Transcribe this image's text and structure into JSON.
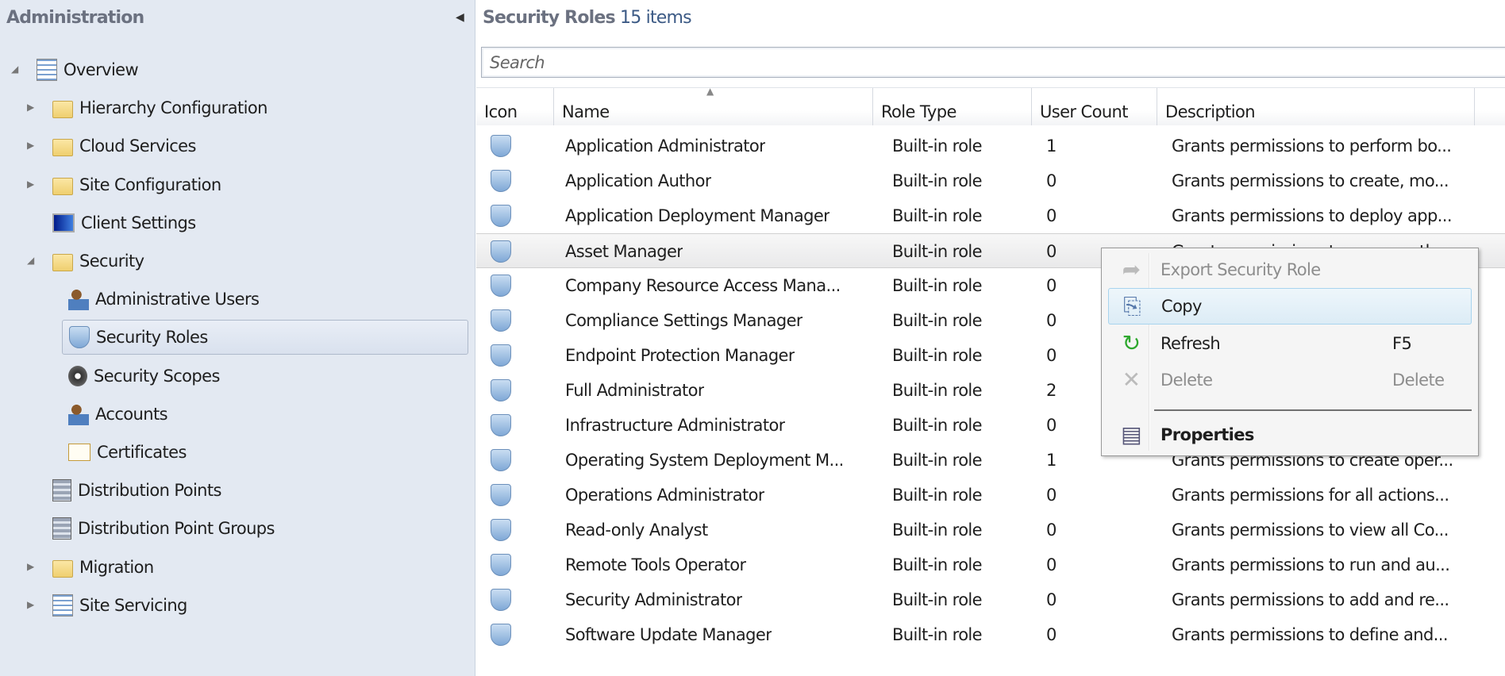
{
  "sidebar": {
    "title": "Administration",
    "items": [
      {
        "label": "Overview",
        "icon": "overview-icon",
        "expander": "expanded"
      },
      {
        "label": "Hierarchy Configuration",
        "icon": "folder-icon",
        "expander": "collapsed"
      },
      {
        "label": "Cloud Services",
        "icon": "folder-icon",
        "expander": "collapsed"
      },
      {
        "label": "Site Configuration",
        "icon": "folder-icon",
        "expander": "collapsed"
      },
      {
        "label": "Client Settings",
        "icon": "monitor-icon",
        "expander": "none"
      },
      {
        "label": "Security",
        "icon": "folder-icon",
        "expander": "expanded"
      },
      {
        "label": "Administrative Users",
        "icon": "admin-user-icon",
        "expander": "none"
      },
      {
        "label": "Security Roles",
        "icon": "security-role-icon",
        "expander": "none",
        "selected": true
      },
      {
        "label": "Security Scopes",
        "icon": "lock-icon",
        "expander": "none"
      },
      {
        "label": "Accounts",
        "icon": "account-icon",
        "expander": "none"
      },
      {
        "label": "Certificates",
        "icon": "certificate-icon",
        "expander": "none"
      },
      {
        "label": "Distribution Points",
        "icon": "server-icon",
        "expander": "none"
      },
      {
        "label": "Distribution Point Groups",
        "icon": "server-group-icon",
        "expander": "none"
      },
      {
        "label": "Migration",
        "icon": "folder-icon",
        "expander": "collapsed"
      },
      {
        "label": "Site Servicing",
        "icon": "site-servicing-icon",
        "expander": "collapsed"
      }
    ]
  },
  "main": {
    "title": "Security Roles",
    "count": "15 items",
    "search_placeholder": "Search",
    "columns": [
      "Icon",
      "Name",
      "Role Type",
      "User Count",
      "Description"
    ],
    "rows": [
      {
        "name": "Application Administrator",
        "type": "Built-in role",
        "count": "1",
        "desc": "Grants permissions to perform bo..."
      },
      {
        "name": "Application Author",
        "type": "Built-in role",
        "count": "0",
        "desc": "Grants permissions to create, mo..."
      },
      {
        "name": "Application Deployment Manager",
        "type": "Built-in role",
        "count": "0",
        "desc": "Grants permissions to deploy app..."
      },
      {
        "name": "Asset Manager",
        "type": "Built-in role",
        "count": "0",
        "desc": "Grants permissions to manage th...",
        "selected": true
      },
      {
        "name": "Company Resource Access Mana...",
        "type": "Built-in role",
        "count": "0",
        "desc": ""
      },
      {
        "name": "Compliance Settings Manager",
        "type": "Built-in role",
        "count": "0",
        "desc": ""
      },
      {
        "name": "Endpoint Protection Manager",
        "type": "Built-in role",
        "count": "0",
        "desc": ""
      },
      {
        "name": "Full Administrator",
        "type": "Built-in role",
        "count": "2",
        "desc": ""
      },
      {
        "name": "Infrastructure Administrator",
        "type": "Built-in role",
        "count": "0",
        "desc": ""
      },
      {
        "name": "Operating System Deployment M...",
        "type": "Built-in role",
        "count": "1",
        "desc": "Grants permissions to create oper..."
      },
      {
        "name": "Operations Administrator",
        "type": "Built-in role",
        "count": "0",
        "desc": "Grants permissions for all actions..."
      },
      {
        "name": "Read-only Analyst",
        "type": "Built-in role",
        "count": "0",
        "desc": "Grants permissions to view all Co..."
      },
      {
        "name": "Remote Tools Operator",
        "type": "Built-in role",
        "count": "0",
        "desc": "Grants permissions to run and au..."
      },
      {
        "name": "Security Administrator",
        "type": "Built-in role",
        "count": "0",
        "desc": "Grants permissions to add and re..."
      },
      {
        "name": "Software Update Manager",
        "type": "Built-in role",
        "count": "0",
        "desc": "Grants permissions to define and..."
      }
    ]
  },
  "context_menu": {
    "items": [
      {
        "label": "Export Security Role",
        "shortcut": "",
        "icon": "export-icon",
        "disabled": true
      },
      {
        "label": "Copy",
        "shortcut": "",
        "icon": "copy-icon",
        "highlighted": true
      },
      {
        "label": "Refresh",
        "shortcut": "F5",
        "icon": "refresh-icon"
      },
      {
        "label": "Delete",
        "shortcut": "Delete",
        "icon": "delete-icon",
        "disabled": true
      },
      {
        "label": "Properties",
        "shortcut": "",
        "icon": "properties-icon",
        "bold": true
      }
    ]
  },
  "colors": {
    "sidebar_bg": "#e3e9f2",
    "menu_highlight": "#dcecf6",
    "refresh_green": "#2ea82e"
  }
}
